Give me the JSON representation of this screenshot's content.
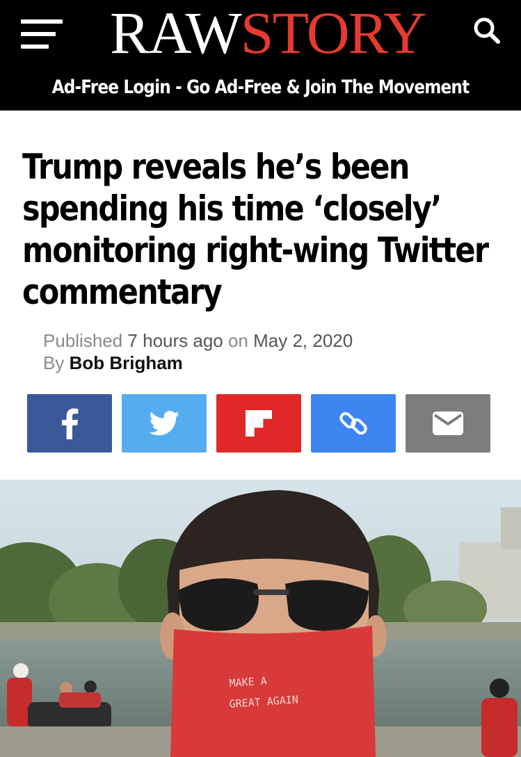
{
  "header": {
    "logo_part1": "RAW",
    "logo_part2": "STORY",
    "ad_bar": "Ad-Free Login - Go Ad-Free & Join The Movement",
    "menu_icon": "hamburger-menu-icon",
    "search_icon": "search-icon",
    "background_color": "#000000",
    "brand_red": "#e63a2e"
  },
  "article": {
    "headline": "Trump reveals he’s been spending his time ‘closely’ monitoring right-wing Twitter commentary",
    "published_prefix": "Published ",
    "time_ago": "7 hours ago",
    "on_word": " on ",
    "date": "May 2, 2020",
    "by_prefix": "By ",
    "author": "Bob Brigham"
  },
  "share_buttons": [
    {
      "name": "facebook",
      "icon": "facebook-icon",
      "color": "#3b5998"
    },
    {
      "name": "twitter",
      "icon": "twitter-icon",
      "color": "#55acee"
    },
    {
      "name": "flipboard",
      "icon": "flipboard-icon",
      "color": "#e12828"
    },
    {
      "name": "copy-link",
      "icon": "link-icon",
      "color": "#3d85f0"
    },
    {
      "name": "email",
      "icon": "email-icon",
      "color": "#7d7d7d"
    }
  ],
  "photo": {
    "mask_text_line1": "MAKE A",
    "mask_text_line2": "GREAT AGAIN"
  }
}
